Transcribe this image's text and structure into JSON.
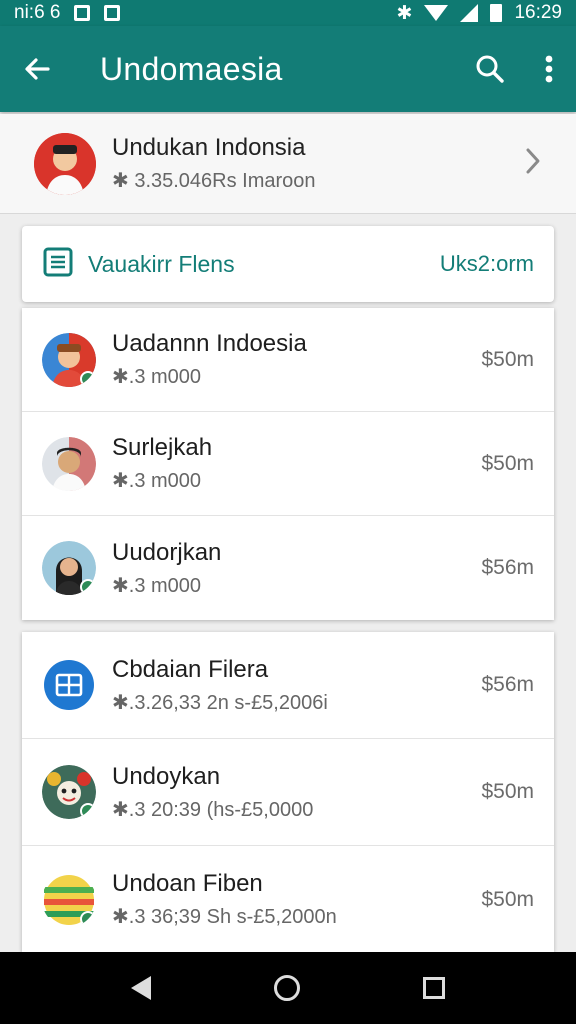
{
  "status_bar": {
    "time_left": "ni:6 6",
    "time_right": "16:29"
  },
  "app_bar": {
    "title": "Undomaesia"
  },
  "profile": {
    "name": "Undukan Indonsia",
    "subtitle": "✱ 3.35.046Rs Imaroon"
  },
  "section": {
    "title": "Vauakirr Flens",
    "action": "Uks2:orm"
  },
  "group1": [
    {
      "title": "Uadannn Indoesia",
      "subtitle": "✱.3 m000",
      "amount": "$50m"
    },
    {
      "title": "Surlejkah",
      "subtitle": "✱.3 m000",
      "amount": "$50m"
    },
    {
      "title": "Uudorjkan",
      "subtitle": "✱.3 m000",
      "amount": "$56m"
    }
  ],
  "group2": [
    {
      "title": "Cbdaian Filera",
      "subtitle": "✱.3.26,33 2n s-£5,2006i",
      "amount": "$56m"
    },
    {
      "title": "Undoykan",
      "subtitle": "✱.3 20:39 (hs-£5,0000",
      "amount": "$50m"
    },
    {
      "title": "Undoan Fiben",
      "subtitle": "✱.3 36;39 Sh s-£5,2000n",
      "amount": "$50m"
    }
  ],
  "icons": {
    "back": "arrow-left-icon",
    "search": "search-icon",
    "more": "more-vert-icon",
    "chevron": "chevron-right-icon",
    "section": "document-icon"
  },
  "colors": {
    "primary": "#137d77",
    "status_bar": "#0f7a72",
    "nav_bar": "#000000"
  }
}
